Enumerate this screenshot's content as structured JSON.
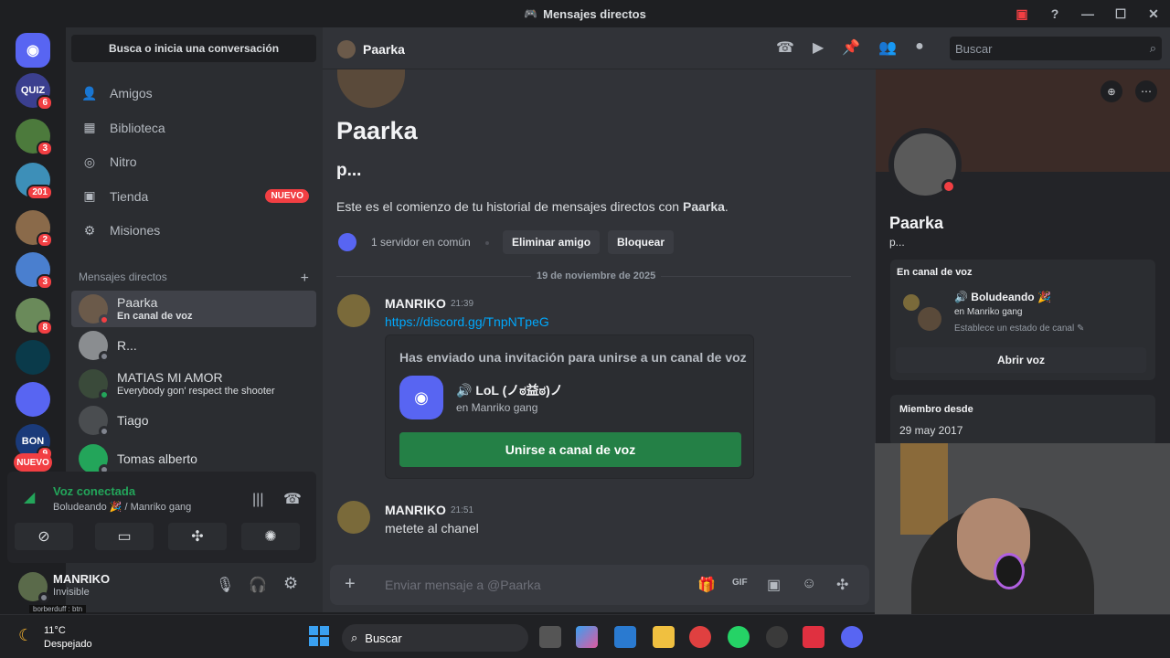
{
  "window": {
    "title": "Mensajes directos"
  },
  "servers": [
    {
      "label": "QUIZ",
      "badge": "6",
      "color": "#3b3f8f"
    },
    {
      "label": "",
      "badge": "3",
      "color": "#4c7a3c"
    },
    {
      "label": "",
      "badge": "201",
      "color": "#3d8fb8"
    },
    {
      "label": "",
      "badge": "2",
      "color": "#8a6a4a"
    },
    {
      "label": "",
      "badge": "3",
      "color": "#4a7fcf"
    },
    {
      "label": "",
      "badge": "8",
      "color": "#6a8a5a"
    },
    {
      "label": "",
      "badge": "",
      "color": "#0a3a4a"
    },
    {
      "label": "",
      "badge": "",
      "color": "#5865f2"
    },
    {
      "label": "BON",
      "badge": "9",
      "color": "#1a3a7a"
    },
    {
      "label": "NUEVO",
      "badge": "",
      "color": "#f23f43"
    }
  ],
  "sidebar": {
    "search": "Busca o inicia una conversación",
    "nav": [
      {
        "label": "Amigos",
        "icon": "friends-icon"
      },
      {
        "label": "Biblioteca",
        "icon": "library-icon"
      },
      {
        "label": "Nitro",
        "icon": "nitro-icon"
      },
      {
        "label": "Tienda",
        "icon": "shop-icon",
        "badge": "NUEVO"
      },
      {
        "label": "Misiones",
        "icon": "quests-icon"
      }
    ],
    "dm_header": "Mensajes directos",
    "dms": [
      {
        "name": "Paarka",
        "sub": "En canal de voz",
        "status": "#f23f43",
        "color": "#6b5a4a"
      },
      {
        "name": "R...",
        "sub": "",
        "status": "#80848e",
        "color": "#8a8d90"
      },
      {
        "name": "MATIAS MI AMOR",
        "sub": "Everybody gon' respect the shooter",
        "status": "#23a55a",
        "color": "#3a4a3a"
      },
      {
        "name": "Tiago",
        "sub": "",
        "status": "#80848e",
        "color": "#4a4d50"
      },
      {
        "name": "Tomas alberto",
        "sub": "",
        "status": "#80848e",
        "color": "#23a55a"
      }
    ]
  },
  "voice": {
    "title": "Voz conectada",
    "sub": "Boludeando 🎉 / Manriko gang"
  },
  "user": {
    "name": "MANRIKO",
    "status": "Invisible",
    "tag": "borberduff : btn"
  },
  "header": {
    "name": "Paarka",
    "search": "Buscar"
  },
  "chat": {
    "title": "Paarka",
    "handle": "p...",
    "intro_pre": "Este es el comienzo de tu historial de mensajes directos con ",
    "intro_name": "Paarka",
    "intro_post": ".",
    "mutual": "1 servidor en común",
    "remove_friend": "Eliminar amigo",
    "block": "Bloquear",
    "date_divider": "19 de noviembre de 2025",
    "messages": [
      {
        "author": "MANRIKO",
        "time": "21:39",
        "text": "https://discord.gg/TnpNTpeG"
      },
      {
        "author": "MANRIKO",
        "time": "21:51",
        "text": "metete al chanel"
      }
    ],
    "invite": {
      "heading": "Has enviado una invitación para unirse a un canal de voz",
      "channel": "🔊 LoL (ノಠ益ಠ)ノ",
      "server": "en Manriko gang",
      "button": "Unirse a canal de voz"
    },
    "composer_placeholder": "Enviar mensaje a @Paarka"
  },
  "profile": {
    "name": "Paarka",
    "handle": "p...",
    "voice_label": "En canal de voz",
    "voice_channel": "🔊 Boludeando 🎉",
    "voice_server": "en Manriko gang",
    "voice_status": "Establece un estado de canal ✎",
    "open_voice": "Abrir voz",
    "member_since_label": "Miembro desde",
    "member_since": "29 may 2017"
  },
  "taskbar": {
    "temp": "11°C",
    "weather": "Despejado",
    "search": "Buscar"
  }
}
